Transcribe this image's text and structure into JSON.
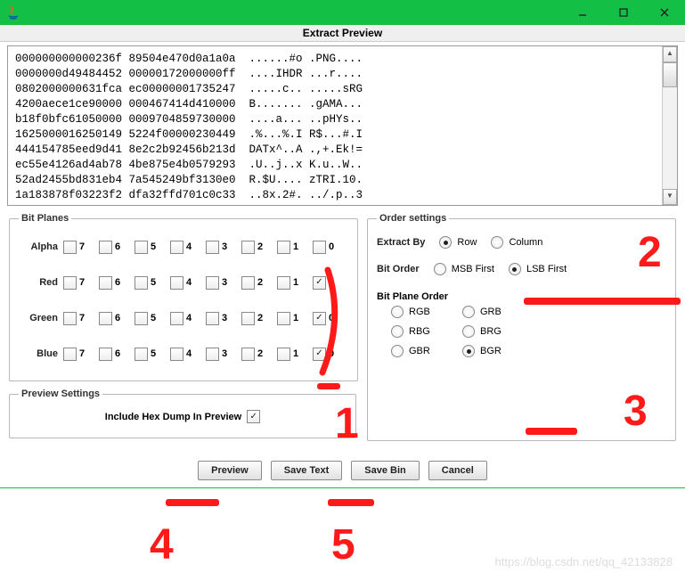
{
  "window": {
    "title": "Extract Preview"
  },
  "preview_text": "000000000000236f 89504e470d0a1a0a  ......#o .PNG....\n0000000d49484452 00000172000000ff  ....IHDR ...r....\n0802000000631fca ec00000001735247  .....c.. .....sRG\n4200aece1ce90000 000467414d410000  B....... .gAMA...\nb18f0bfc61050000 0009704859730000  ....a... ..pHYs..\n1625000016250149 5224f00000230449  .%...%.I R$...#.I\n444154785eed9d41 8e2c2b92456b213d  DATx^..A .,+.Ek!=\nec55e4126ad4ab78 4be875e4b0579293  .U..j..x K.u..W..\n52ad2455bd831eb4 7a545249bf3130e0  R.$U.... zTRI.10.\n1a183878f03223f2 dfa32ffd701c0c33  ..8x.2#. ../.p..3",
  "bit_planes": {
    "legend": "Bit Planes",
    "rows": [
      {
        "label": "Alpha",
        "checked": []
      },
      {
        "label": "Red",
        "checked": [
          0
        ]
      },
      {
        "label": "Green",
        "checked": [
          0
        ]
      },
      {
        "label": "Blue",
        "checked": [
          0
        ]
      }
    ],
    "bits": [
      "7",
      "6",
      "5",
      "4",
      "3",
      "2",
      "1",
      "0"
    ]
  },
  "preview_settings": {
    "legend": "Preview Settings",
    "include_hex_label": "Include Hex Dump In Preview",
    "include_hex_checked": true
  },
  "order_settings": {
    "legend": "Order settings",
    "extract_by_label": "Extract By",
    "extract_by_row": "Row",
    "extract_by_column": "Column",
    "extract_by_value": "Row",
    "bit_order_label": "Bit Order",
    "bit_order_msb": "MSB First",
    "bit_order_lsb": "LSB First",
    "bit_order_value": "LSB First",
    "bit_plane_order_label": "Bit Plane Order",
    "bpo_options": [
      "RGB",
      "GRB",
      "RBG",
      "BRG",
      "GBR",
      "BGR"
    ],
    "bpo_value": "BGR"
  },
  "buttons": {
    "preview": "Preview",
    "save_text": "Save Text",
    "save_bin": "Save Bin",
    "cancel": "Cancel"
  },
  "watermark": "https://blog.csdn.net/qq_42133828",
  "annotations": {
    "n1": "1",
    "n2": "2",
    "n3": "3",
    "n4": "4",
    "n5": "5"
  }
}
